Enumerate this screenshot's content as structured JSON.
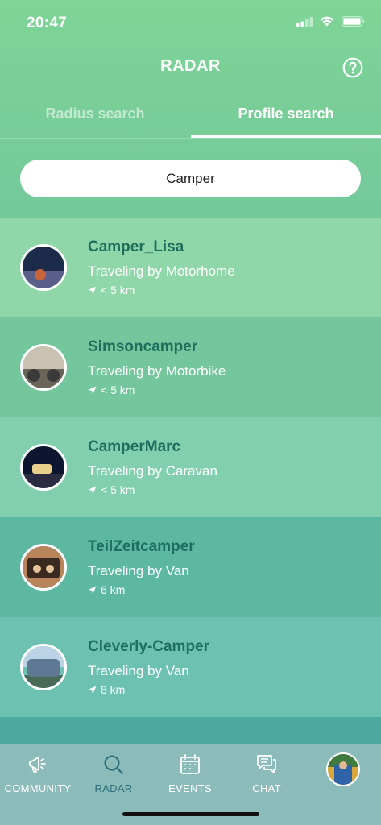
{
  "status_bar": {
    "time": "20:47"
  },
  "nav": {
    "title": "RADAR",
    "help_icon": "question-circle-icon"
  },
  "tabs": [
    {
      "label": "Radius search",
      "active": false
    },
    {
      "label": "Profile search",
      "active": true
    }
  ],
  "search": {
    "value": "Camper",
    "placeholder": ""
  },
  "results": [
    {
      "name": "Camper_Lisa",
      "travel": "Traveling by Motorhome",
      "distance": "< 5 km",
      "bg": "#8fd6a8",
      "avatar_colors": [
        "#1c2b4a",
        "#5a5e8a",
        "#c7643a"
      ]
    },
    {
      "name": "Simsoncamper",
      "travel": "Traveling by Motorbike",
      "distance": "< 5 km",
      "bg": "#74c69c",
      "avatar_colors": [
        "#c9c2b2",
        "#6b6458",
        "#3a3a3a"
      ]
    },
    {
      "name": "CamperMarc",
      "travel": "Traveling by Caravan",
      "distance": "< 5 km",
      "bg": "#81cfaf",
      "avatar_colors": [
        "#0e1530",
        "#2a2a40",
        "#e8d08a"
      ]
    },
    {
      "name": "TeilZeitcamper",
      "travel": "Traveling by Van",
      "distance": "6 km",
      "bg": "#5cb8a0",
      "avatar_colors": [
        "#b8845a",
        "#3b2a20",
        "#e7c39a"
      ]
    },
    {
      "name": "Cleverly-Camper",
      "travel": "Traveling by Van",
      "distance": "8 km",
      "bg": "#6cc1b0",
      "avatar_colors": [
        "#bcd3e6",
        "#5f7894",
        "#4a6a58"
      ]
    },
    {
      "name": "",
      "travel": "",
      "distance": "",
      "bg": "#4ea9a3",
      "avatar_colors": [
        "#888888",
        "#666666",
        "#444444"
      ]
    }
  ],
  "tabbar": [
    {
      "label": "COMMUNITY",
      "icon": "megaphone-icon",
      "active": false
    },
    {
      "label": "RADAR",
      "icon": "search-icon",
      "active": true
    },
    {
      "label": "EVENTS",
      "icon": "calendar-icon",
      "active": false
    },
    {
      "label": "CHAT",
      "icon": "chat-bubbles-icon",
      "active": false
    },
    {
      "label": "",
      "icon": "profile-avatar",
      "active": false
    }
  ],
  "colors": {
    "name_text": "#1f6f5e",
    "active_tab_label": "#2e6e7a",
    "tabbar_bg": "#8cbcba"
  }
}
